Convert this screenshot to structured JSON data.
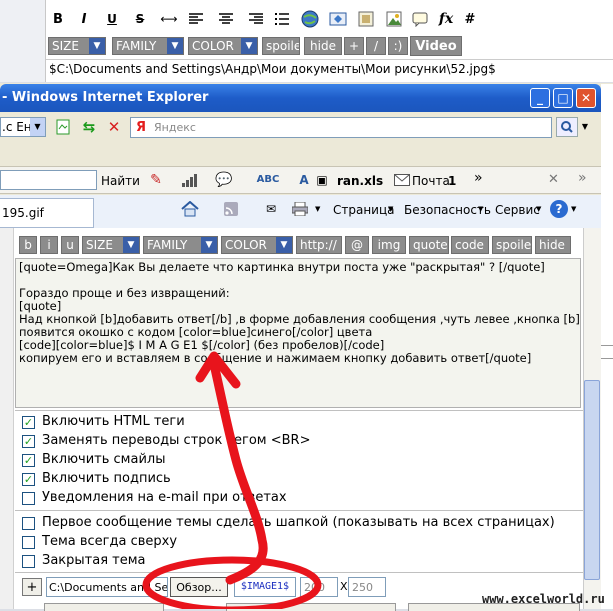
{
  "top_editor": {
    "format_icons": [
      "bold-icon",
      "italic-icon",
      "underline-icon",
      "strike-icon",
      "hr-icon",
      "align-left-icon",
      "align-center-icon",
      "align-right-icon",
      "list-icon",
      "globe-link-icon",
      "email-icon",
      "image-icon",
      "picture-icon",
      "quote-icon",
      "function-icon",
      "hash-icon"
    ],
    "glyphs": {
      "bold": "B",
      "italic": "I",
      "underline": "U",
      "strike": "S",
      "hr": "⟷",
      "fx": "fx",
      "hash": "#"
    },
    "size_label": "SIZE",
    "family_label": "FAMILY",
    "color_label": "COLOR",
    "spoiler_label": "spoile",
    "hide_label": "hide",
    "plus_label": "+",
    "slash_label": "/",
    "smile_label": ":)",
    "video_label": "Video",
    "path_text": "$C:\\Documents and Settings\\Андр\\Мои документы\\Мои рисунки\\52.jpg$"
  },
  "ie_window": {
    "title": "- Windows Internet Explorer",
    "controls": {
      "minimize": "_",
      "maximize": "□",
      "close": "✕"
    },
    "address_text": ".c Ен",
    "search_placeholder": "Яндекс",
    "find_label": "Найти",
    "ran_file": "ran.xls",
    "mail_label": "Почта",
    "mail_count": "1",
    "more_label": "»",
    "toolbar_close": "✕",
    "tab_label": "195.gif",
    "cmd": {
      "page": "Страница",
      "security": "Безопасность",
      "service": "Сервис",
      "help": "?"
    }
  },
  "inner_editor": {
    "buttons": [
      "b",
      "i",
      "u",
      "SIZE",
      "FAMILY",
      "COLOR",
      "http://",
      "@",
      "img",
      "quote",
      "code",
      "spoile",
      "hide"
    ],
    "text_lines": [
      "[quote=Omega]Как Вы делаете что картинка внутри поста уже \"раскрытая\" ? [/quote]",
      "",
      "Гораздо проще и без извращений:",
      "[quote]",
      "Над кнопкой [b]добавить ответ[/b] ,в форме добавления сообщения ,чуть левее ,кнопка [b]о",
      "появится окошко с кодом [color=blue]синего[/color] цвета",
      "[code][color=blue]$ I M A G E1 $[/color] (без пробелов)[/code]",
      "копируем его и вставляем в сообщение и нажимаем кнопку добавить ответ[/quote]"
    ]
  },
  "options": [
    {
      "label": "Включить HTML теги",
      "checked": true
    },
    {
      "label": "Заменять переводы строк тегом <BR>",
      "checked": true
    },
    {
      "label": "Включить смайлы",
      "checked": true
    },
    {
      "label": "Включить подпись",
      "checked": true
    },
    {
      "label": "Уведомления на e-mail при ответах",
      "checked": false
    }
  ],
  "topic_options": [
    {
      "label": "Первое сообщение темы сделать шапкой (показывать на всех страницах)",
      "checked": false
    },
    {
      "label": "Тема всегда сверху",
      "checked": false
    },
    {
      "label": "Закрытая тема",
      "checked": false
    }
  ],
  "upload": {
    "add_label": "+",
    "file_path": "C:\\Documents and Setti",
    "browse_label": "Обзор...",
    "image_code": "$IMAGE1$",
    "width": "200",
    "x_label": "X",
    "height": "250"
  },
  "watermark": "www.excelworld.ru",
  "colors": {
    "annotation": "#e8141c",
    "ie_title": "#2f6bd0",
    "button_gray": "#8c8c8c"
  }
}
